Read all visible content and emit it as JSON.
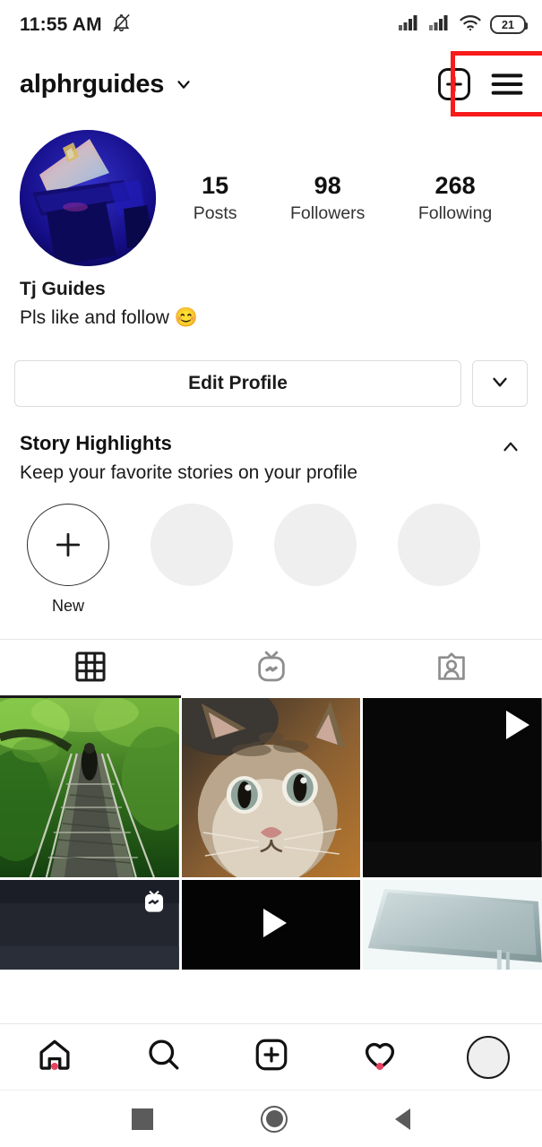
{
  "status_bar": {
    "time": "11:55 AM",
    "icons": [
      "bell-muted-icon",
      "signal-icon",
      "signal-icon",
      "wifi-icon"
    ],
    "battery_level": "21"
  },
  "header": {
    "username": "alphrguides",
    "dropdown_icon": "chevron-down-icon",
    "add_label": "+",
    "add_icon": "plus-square-icon",
    "menu_icon": "hamburger-menu-icon",
    "highlight_color": "#f81b1b"
  },
  "profile": {
    "avatar_alt": "blue-lit desk setup with monitor",
    "stats": [
      {
        "value": "15",
        "label": "Posts"
      },
      {
        "value": "98",
        "label": "Followers"
      },
      {
        "value": "268",
        "label": "Following"
      }
    ],
    "display_name": "Tj Guides",
    "bio": "Pls like and follow 😊"
  },
  "actions": {
    "edit_profile_label": "Edit Profile",
    "caret_icon": "chevron-down-icon"
  },
  "story_highlights": {
    "title": "Story Highlights",
    "subtitle": "Keep your favorite stories on your profile",
    "collapse_icon": "chevron-up-icon",
    "new_label": "New",
    "new_icon": "plus-icon",
    "placeholder_count": 3
  },
  "tabs": [
    {
      "name": "grid",
      "icon": "grid-icon",
      "active": true
    },
    {
      "name": "igtv",
      "icon": "igtv-icon",
      "active": false
    },
    {
      "name": "tagged",
      "icon": "tagged-person-icon",
      "active": false
    }
  ],
  "grid_posts": [
    {
      "kind": "photo",
      "alt": "jungle rope bridge",
      "badge": null
    },
    {
      "kind": "photo",
      "alt": "tabby kitten close-up",
      "badge": null
    },
    {
      "kind": "video",
      "alt": "black video thumbnail",
      "badge": "play-icon"
    },
    {
      "kind": "igtv",
      "alt": "dark desk photo",
      "badge": "igtv-icon"
    },
    {
      "kind": "video",
      "alt": "black video thumbnail",
      "badge": "play-icon"
    },
    {
      "kind": "photo",
      "alt": "angled monitor screen",
      "badge": null
    }
  ],
  "bottom_nav": [
    {
      "name": "home",
      "icon": "home-icon",
      "badge_dot": true
    },
    {
      "name": "search",
      "icon": "search-icon",
      "badge_dot": false
    },
    {
      "name": "create",
      "icon": "plus-square-icon",
      "badge_dot": false
    },
    {
      "name": "activity",
      "icon": "heart-icon",
      "badge_dot": true
    },
    {
      "name": "profile",
      "icon": "avatar-icon",
      "badge_dot": false
    }
  ],
  "android_nav": [
    {
      "name": "recents",
      "icon": "square-icon"
    },
    {
      "name": "home",
      "icon": "circle-icon"
    },
    {
      "name": "back",
      "icon": "triangle-left-icon"
    }
  ]
}
